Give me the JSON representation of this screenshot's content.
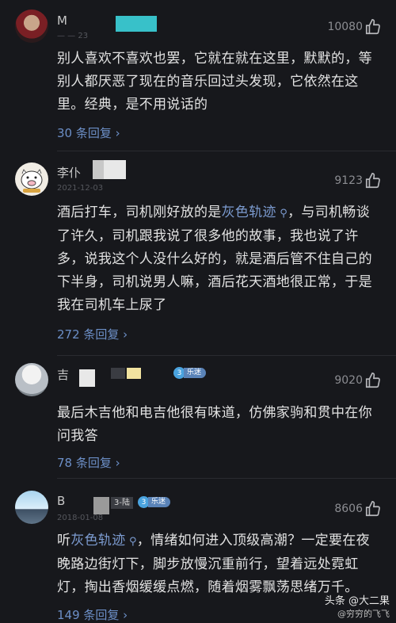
{
  "comments": [
    {
      "name": "M",
      "date": "— — 23",
      "likes": "10080",
      "text": "别人喜欢不喜欢也罢，它就在就在这里，默默的，等别人都厌恶了现在的音乐回过头发现，它依然在这里。经典，是不用说话的",
      "replies": "30 条回复"
    },
    {
      "name": "李仆",
      "date": "2021-12-03",
      "likes": "9123",
      "text_pre": "酒后打车，司机刚好放的是",
      "text_link": "灰色轨迹",
      "text_post": "，与司机畅谈了许久，司机跟我说了很多他的故事，我也说了许多，说我这个人没什么好的，就是酒后管不住自己的下半身，司机说男人嘛，酒后花天酒地很正常，于是我在司机车上尿了",
      "replies": "272 条回复"
    },
    {
      "name": "吉",
      "date": "",
      "likes": "9020",
      "badge_level": "3",
      "badge_text": "乐迷",
      "text": "最后木吉他和电吉他很有味道，仿佛家驹和贯中在你问我答",
      "replies": "78 条回复"
    },
    {
      "name": "B",
      "date": "2018-01-08",
      "likes": "8606",
      "tag": "3-陆",
      "badge_level": "3",
      "badge_text": "乐迷",
      "text_pre": "听",
      "text_link": "灰色轨迹",
      "text_post": "，情绪如何进入顶级高潮？一定要在夜晚路边街灯下，脚步放慢沉重前行，望着远处霓虹灯，掏出香烟缓缓点燃，随着烟雾飘荡思绪万千。",
      "replies": "149 条回复"
    }
  ],
  "watermark": {
    "line1": "头条 @大二果",
    "line2": "@穷穷的飞飞"
  }
}
